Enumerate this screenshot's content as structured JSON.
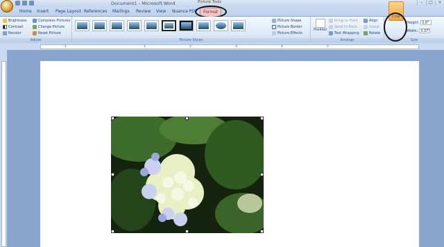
{
  "window": {
    "title": "Document1 - Microsoft Word",
    "context_group": "Picture Tools",
    "controls": [
      "–",
      "□",
      "×"
    ]
  },
  "tabs": [
    "Home",
    "Insert",
    "Page Layout",
    "References",
    "Mailings",
    "Review",
    "View",
    "Nuance PDF",
    "Format"
  ],
  "active_tab": "Format",
  "ribbon": {
    "adjust": {
      "label": "Adjust",
      "brightness": "Brightness",
      "contrast": "Contrast",
      "recolor": "Recolor",
      "compress": "Compress Pictures",
      "change": "Change Picture",
      "reset": "Reset Picture"
    },
    "styles": {
      "label": "Picture Styles",
      "shape": "Picture Shape",
      "border": "Picture Border",
      "effects": "Picture Effects"
    },
    "arrange": {
      "label": "Arrange",
      "position": "Position",
      "bring_front": "Bring to Front",
      "send_back": "Send to Back",
      "text_wrapping": "Text Wrapping",
      "align": "Align",
      "group": "Group",
      "rotate": "Rotate"
    },
    "size": {
      "label": "Size",
      "crop": "Crop",
      "height_label": "Height:",
      "height_value": "2.6\"",
      "width_label": "Width:",
      "width_value": "3.37\""
    }
  },
  "ruler_numbers": [
    "1",
    "1",
    "2",
    "3",
    "4",
    "5"
  ],
  "colors": {
    "ribbon_text": "#15428b",
    "active_tab": "#f2c7c7",
    "crop_highlight": "#f3a63c",
    "workspace": "#8aa6cf"
  }
}
